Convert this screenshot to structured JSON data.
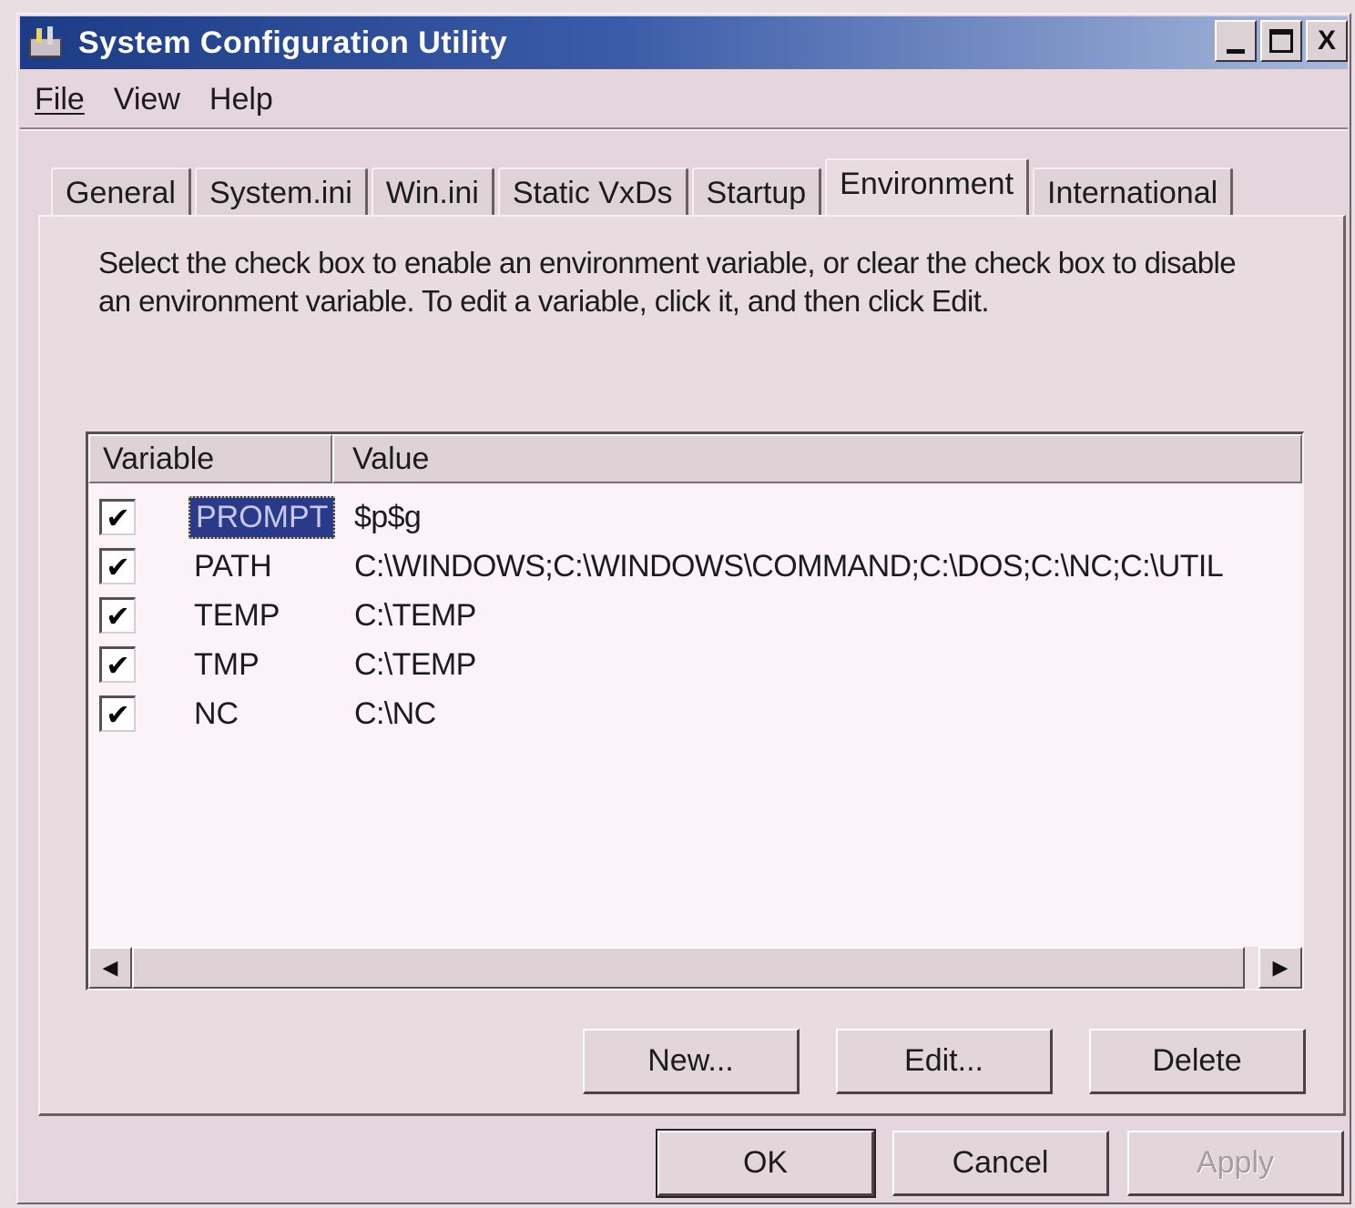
{
  "window": {
    "title": "System Configuration Utility",
    "controls": {
      "minimize": "_",
      "maximize": "□",
      "close": "X"
    }
  },
  "menu": {
    "file": "File",
    "view": "View",
    "help": "Help"
  },
  "tabs": [
    {
      "label": "General",
      "active": false
    },
    {
      "label": "System.ini",
      "active": false
    },
    {
      "label": "Win.ini",
      "active": false
    },
    {
      "label": "Static VxDs",
      "active": false
    },
    {
      "label": "Startup",
      "active": false
    },
    {
      "label": "Environment",
      "active": true
    },
    {
      "label": "International",
      "active": false
    }
  ],
  "environment": {
    "description": "Select the check box to enable an environment variable, or clear the check box to disable an environment variable. To edit a variable, click it, and then click Edit.",
    "columns": {
      "variable": "Variable",
      "value": "Value"
    },
    "rows": [
      {
        "checked": true,
        "variable": "PROMPT",
        "value": "$p$g",
        "selected": true
      },
      {
        "checked": true,
        "variable": "PATH",
        "value": "C:\\WINDOWS;C:\\WINDOWS\\COMMAND;C:\\DOS;C:\\NC;C:\\UTIL",
        "selected": false
      },
      {
        "checked": true,
        "variable": "TEMP",
        "value": "C:\\TEMP",
        "selected": false
      },
      {
        "checked": true,
        "variable": "TMP",
        "value": "C:\\TEMP",
        "selected": false
      },
      {
        "checked": true,
        "variable": "NC",
        "value": "C:\\NC",
        "selected": false
      }
    ],
    "scroll_left": "◀",
    "scroll_right": "▶",
    "buttons": {
      "new": "New...",
      "edit": "Edit...",
      "delete": "Delete"
    }
  },
  "dialog_buttons": {
    "ok": "OK",
    "cancel": "Cancel",
    "apply": "Apply",
    "apply_enabled": false
  },
  "checkmark": "✔"
}
